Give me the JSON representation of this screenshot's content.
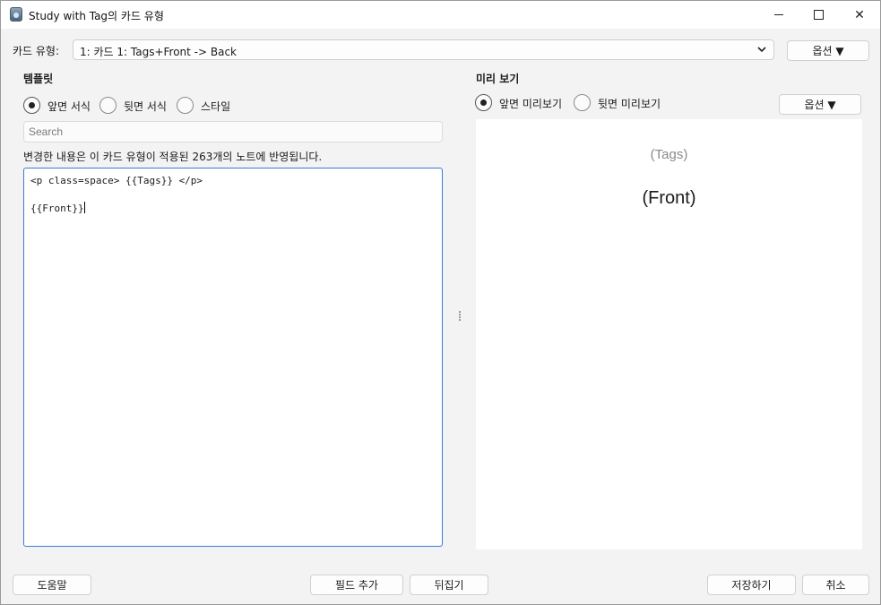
{
  "window": {
    "title": "Study with Tag의 카드 유형",
    "controls": {
      "minimize": "",
      "maximize": "",
      "close": "✕"
    }
  },
  "card_type": {
    "label": "카드 유형:",
    "selected": "1: 카드 1: Tags+Front -> Back",
    "options_button": "옵션 ▼"
  },
  "template": {
    "heading": "템플릿",
    "radios": [
      {
        "label": "앞면 서식",
        "checked": true
      },
      {
        "label": "뒷면 서식",
        "checked": false
      },
      {
        "label": "스타일",
        "checked": false
      }
    ],
    "search_placeholder": "Search",
    "info": "변경한 내용은 이 카드 유형이 적용된 263개의 노트에 반영됩니다.",
    "code_lines": [
      "<p class=space> {{Tags}} </p>",
      "",
      "{{Front}}"
    ]
  },
  "preview": {
    "heading": "미리 보기",
    "radios": [
      {
        "label": "앞면 미리보기",
        "checked": true
      },
      {
        "label": "뒷면 미리보기",
        "checked": false
      }
    ],
    "options_button": "옵션 ▼",
    "tags_text": "(Tags)",
    "front_text": "(Front)"
  },
  "footer": {
    "help": "도움말",
    "add_field": "필드 추가",
    "flip": "뒤집기",
    "save": "저장하기",
    "cancel": "취소"
  },
  "colors": {
    "accent": "#3a7bd5",
    "window_bg": "#f3f3f3",
    "preview_bg": "#ffffff",
    "muted_text": "#8a8a8a"
  }
}
